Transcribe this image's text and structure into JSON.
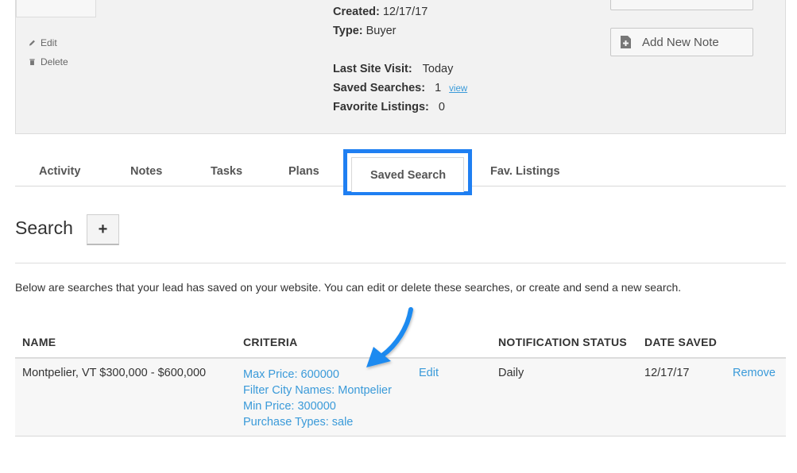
{
  "lead": {
    "edit_label": "Edit",
    "delete_label": "Delete",
    "created_label": "Created:",
    "created_value": "12/17/17",
    "type_label": "Type:",
    "type_value": "Buyer",
    "last_visit_label": "Last Site Visit:",
    "last_visit_value": "Today",
    "saved_searches_label": "Saved Searches:",
    "saved_searches_value": "1",
    "saved_searches_link": "view",
    "favorite_listings_label": "Favorite Listings:",
    "favorite_listings_value": "0",
    "add_note_label": "Add New Note"
  },
  "tabs": [
    {
      "label": "Activity"
    },
    {
      "label": "Notes"
    },
    {
      "label": "Tasks"
    },
    {
      "label": "Plans"
    },
    {
      "label": "Saved Search",
      "active": true
    },
    {
      "label": "Fav. Listings"
    }
  ],
  "search": {
    "title": "Search",
    "add_label": "+",
    "description": "Below are searches that your lead has saved on your website. You can edit or delete these searches, or create and send a new search."
  },
  "table": {
    "headers": [
      "NAME",
      "CRITERIA",
      "NOTIFICATION STATUS",
      "DATE SAVED"
    ],
    "rows": [
      {
        "name": "Montpelier, VT $300,000 - $600,000",
        "criteria": [
          "Max Price: 600000",
          "Filter City Names: Montpelier",
          "Min Price: 300000",
          "Purchase Types: sale"
        ],
        "edit_label": "Edit",
        "notification_status": "Daily",
        "date_saved": "12/17/17",
        "remove_label": "Remove"
      }
    ]
  },
  "colors": {
    "highlight": "#1f7ff2",
    "link": "#3a9ad9",
    "panel_bg": "#f2f2f2"
  },
  "icons": {
    "edit": "pencil-icon",
    "delete": "trash-icon",
    "add_note": "note-plus-icon",
    "annotation": "arrow-annotation-icon"
  }
}
